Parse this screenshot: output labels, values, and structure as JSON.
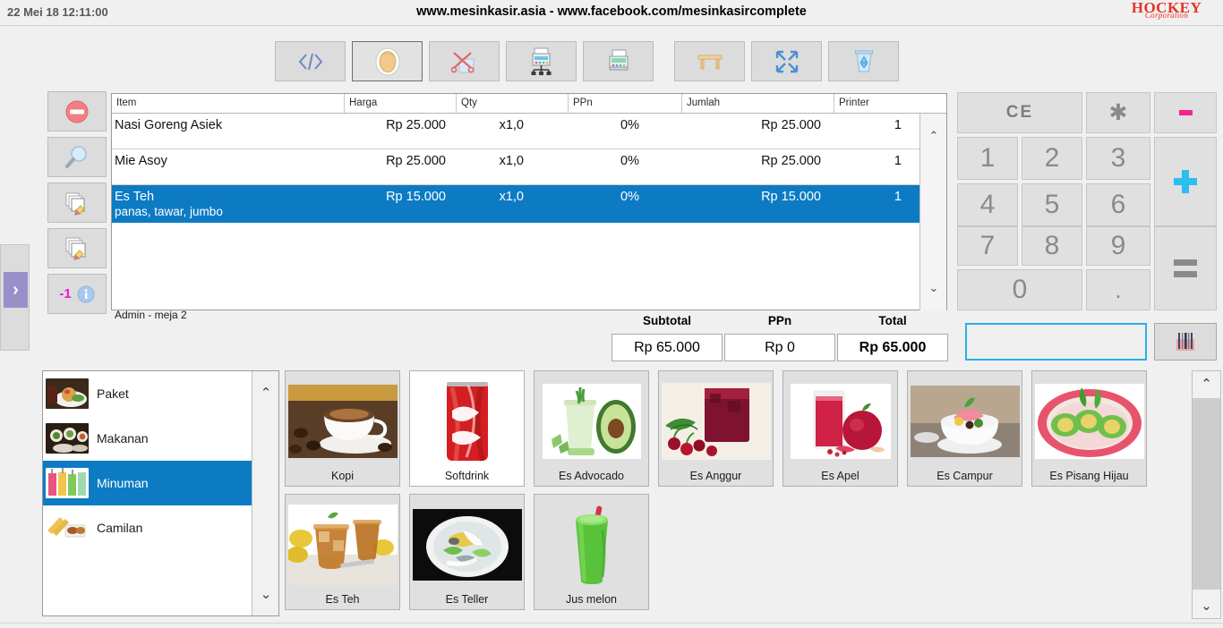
{
  "header": {
    "clock": "22 Mei 18 12:11:00",
    "site_title": "www.mesinkasir.asia - www.facebook.com/mesinkasircomplete",
    "brand_main": "HOCKEY",
    "brand_sub": "Corporation"
  },
  "toolbar": {
    "buttons": [
      {
        "name": "code-icon",
        "label": "</>"
      },
      {
        "name": "customer-icon",
        "label": ""
      },
      {
        "name": "cut-void-icon",
        "label": ""
      },
      {
        "name": "cash-register-network-icon",
        "label": ""
      },
      {
        "name": "printer-icon",
        "label": ""
      },
      {
        "name": "table-icon",
        "label": ""
      },
      {
        "name": "fullscreen-icon",
        "label": ""
      },
      {
        "name": "recycle-bin-icon",
        "label": ""
      }
    ]
  },
  "side_buttons": {
    "delete": "delete-item-icon",
    "search": "search-icon",
    "edit_copy": "edit-copy-icon",
    "edit_copy_alt": "edit-copy-alt-icon",
    "decrement_label": "-1",
    "info": "info-icon"
  },
  "edge_panel": {
    "toggle_label": "›"
  },
  "order": {
    "columns": [
      "Item",
      "Harga",
      "Qty",
      "PPn",
      "Jumlah",
      "Printer"
    ],
    "rows": [
      {
        "item": "Nasi Goreng Asiek",
        "note": "",
        "harga": "Rp 25.000",
        "qty": "x1,0",
        "ppn": "0%",
        "jumlah": "Rp 25.000",
        "printer": "1",
        "selected": false
      },
      {
        "item": "Mie Asoy",
        "note": "",
        "harga": "Rp 25.000",
        "qty": "x1,0",
        "ppn": "0%",
        "jumlah": "Rp 25.000",
        "printer": "1",
        "selected": false
      },
      {
        "item": "Es Teh",
        "note": "panas, tawar, jumbo",
        "harga": "Rp 15.000",
        "qty": "x1,0",
        "ppn": "0%",
        "jumlah": "Rp 15.000",
        "printer": "1",
        "selected": true
      }
    ],
    "scroll_up": "⌃",
    "scroll_down": "⌄"
  },
  "totals": {
    "cashier": "Admin - meja 2",
    "subtotal_label": "Subtotal",
    "subtotal_value": "Rp 65.000",
    "ppn_label": "PPn",
    "ppn_value": "Rp 0",
    "total_label": "Total",
    "total_value": "Rp 65.000"
  },
  "keypad": {
    "ce": "CE",
    "asterisk": "✱",
    "minus": "minus-key-icon",
    "plus": "plus-key-icon",
    "equals": "equals-key-icon",
    "k1": "1",
    "k2": "2",
    "k3": "3",
    "k4": "4",
    "k5": "5",
    "k6": "6",
    "k7": "7",
    "k8": "8",
    "k9": "9",
    "k0": "0",
    "dot": "."
  },
  "barcode": {
    "value": "",
    "placeholder": "",
    "button_icon": "barcode-scan-icon"
  },
  "categories": [
    {
      "label": "Paket",
      "selected": false
    },
    {
      "label": "Makanan",
      "selected": false
    },
    {
      "label": "Minuman",
      "selected": true
    },
    {
      "label": "Camilan",
      "selected": false
    }
  ],
  "products": [
    {
      "label": "Kopi",
      "white": false
    },
    {
      "label": "Softdrink",
      "white": true
    },
    {
      "label": "Es Advocado",
      "white": false
    },
    {
      "label": "Es Anggur",
      "white": false
    },
    {
      "label": "Es Apel",
      "white": false
    },
    {
      "label": "Es Campur",
      "white": false
    },
    {
      "label": "Es Pisang Hijau",
      "white": false
    },
    {
      "label": "Es Teh",
      "white": false
    },
    {
      "label": "Es Teller",
      "white": false
    },
    {
      "label": "Jus melon",
      "white": false
    }
  ],
  "scroll": {
    "up": "⌃",
    "down": "⌄"
  },
  "colors": {
    "selection_blue": "#0d7bc4",
    "accent_cyan": "#2dbdf0",
    "accent_pink": "#f5238c",
    "brand_red": "#e8332a",
    "panel_gray": "#f0f0f0",
    "edge_purple": "#9790c9"
  }
}
